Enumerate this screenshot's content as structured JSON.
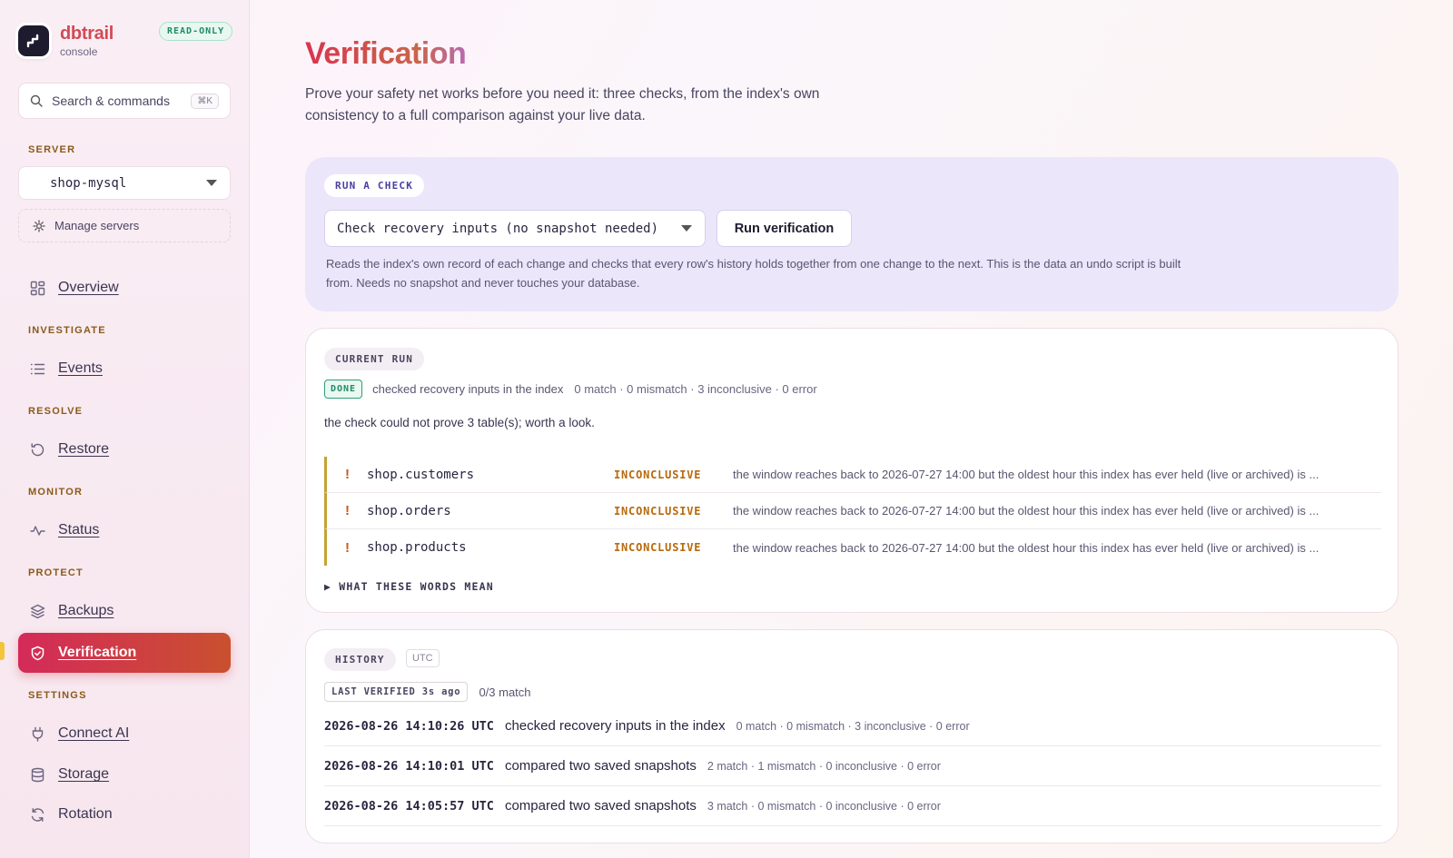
{
  "sidebar": {
    "brand": {
      "name": "dbtrail",
      "sub": "console",
      "badge": "READ-ONLY"
    },
    "search": {
      "label": "Search & commands",
      "shortcut": "⌘K"
    },
    "server_label": "SERVER",
    "server_value": "shop-mysql",
    "manage_servers": "Manage servers",
    "sections": {
      "investigate": "INVESTIGATE",
      "resolve": "RESOLVE",
      "monitor": "MONITOR",
      "protect": "PROTECT",
      "settings": "SETTINGS"
    },
    "nav": {
      "overview": "Overview",
      "events": "Events",
      "restore": "Restore",
      "status": "Status",
      "backups": "Backups",
      "verification": "Verification",
      "connect_ai": "Connect AI",
      "storage": "Storage",
      "rotation": "Rotation"
    },
    "active_color_start": "#d42a5a",
    "active_color_end": "#c9502e"
  },
  "main": {
    "title": "Verification",
    "lede": "Prove your safety net works before you need it: three checks, from the index's own consistency to a full comparison against your live data.",
    "run": {
      "pill": "RUN A CHECK",
      "selected_check": "Check recovery inputs (no snapshot needed)",
      "button": "Run verification",
      "description": "Reads the index's own record of each change and checks that every row's history holds together from one change to the next. This is the data an undo script is built from. Needs no snapshot and never touches your database."
    },
    "current": {
      "pill": "CURRENT RUN",
      "status": "DONE",
      "summary": "checked recovery inputs in the index",
      "counts": "0 match · 0 mismatch · 3 inconclusive · 0 error",
      "note": "the check could not prove 3 table(s); worth a look.",
      "tables": [
        {
          "mark": "!",
          "name": "shop.customers",
          "status": "INCONCLUSIVE",
          "message": "the window reaches back to 2026-07-27 14:00 but the oldest hour this index has ever held (live or archived) is ..."
        },
        {
          "mark": "!",
          "name": "shop.orders",
          "status": "INCONCLUSIVE",
          "message": "the window reaches back to 2026-07-27 14:00 but the oldest hour this index has ever held (live or archived) is ..."
        },
        {
          "mark": "!",
          "name": "shop.products",
          "status": "INCONCLUSIVE",
          "message": "the window reaches back to 2026-07-27 14:00 but the oldest hour this index has ever held (live or archived) is ..."
        }
      ],
      "words_toggle": "▶ WHAT THESE WORDS MEAN"
    },
    "history": {
      "pill": "HISTORY",
      "tz": "UTC",
      "last_verified": "LAST VERIFIED 3s ago",
      "match": "0/3 match",
      "rows": [
        {
          "ts": "2026-08-26 14:10:26 UTC",
          "desc": "checked recovery inputs in the index",
          "counts": "0 match · 0 mismatch · 3 inconclusive · 0 error"
        },
        {
          "ts": "2026-08-26 14:10:01 UTC",
          "desc": "compared two saved snapshots",
          "counts": "2 match · 1 mismatch · 0 inconclusive · 0 error"
        },
        {
          "ts": "2026-08-26 14:05:57 UTC",
          "desc": "compared two saved snapshots",
          "counts": "3 match · 0 mismatch · 0 inconclusive · 0 error"
        }
      ]
    }
  }
}
